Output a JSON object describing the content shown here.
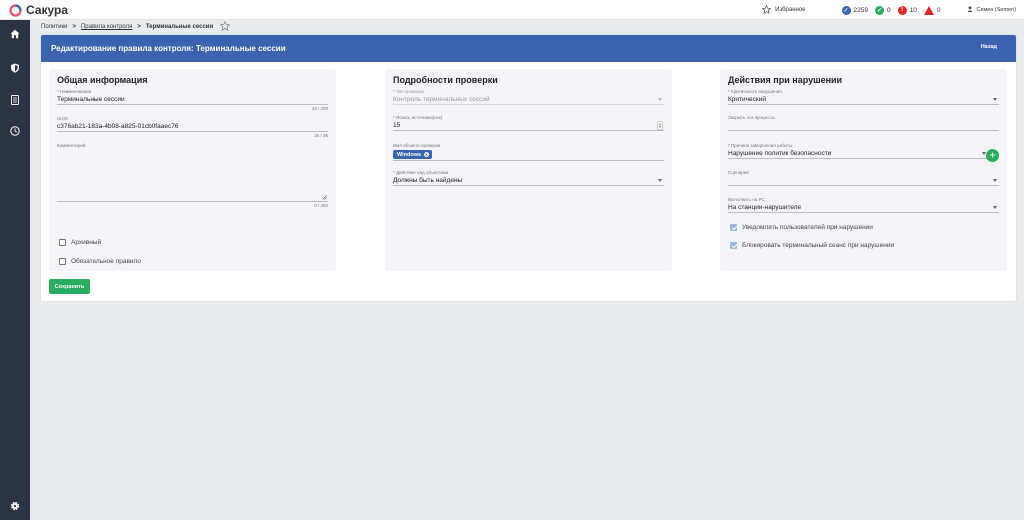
{
  "app": {
    "name": "Сакура"
  },
  "topbar": {
    "favorites_label": "Избранное",
    "counters": [
      {
        "value": "2259",
        "color": "#3a63b0",
        "icon": "check-circle-icon"
      },
      {
        "value": "0",
        "color": "#27ae60",
        "icon": "check-circle-icon"
      },
      {
        "value": "10",
        "color": "#e02424",
        "icon": "exclamation-circle-icon"
      },
      {
        "value": "0",
        "color": "#e02424",
        "icon": "warning-triangle-icon"
      }
    ],
    "user": "Семен (Semen)"
  },
  "sidebar": {
    "items": [
      {
        "icon": "home-icon"
      },
      {
        "icon": "shield-icon"
      },
      {
        "icon": "document-list-icon"
      },
      {
        "icon": "clock-icon"
      }
    ],
    "bottom_icon": "gear-icon"
  },
  "breadcrumb": {
    "items": [
      "Политики",
      "Правила контроля",
      "Терминальные сессии"
    ]
  },
  "card": {
    "title": "Редактирование правила контроля: Терминальные сессии",
    "back_label": "Назад",
    "save_label": "Сохранить"
  },
  "general": {
    "title": "Общая информация",
    "name_label": "* Наименование",
    "name_value": "Терминальные сессии",
    "name_count": "19 / 200",
    "uuid_label": "UUID",
    "uuid_value": "c376ab21-183a-4b08-a825-01cb0faaec76",
    "uuid_count": "36 / 36",
    "comment_label": "Комментарий",
    "comment_count": "0 / 250",
    "archived_label": "Архивный",
    "mandatory_label": "Обязательное правило"
  },
  "details": {
    "title": "Подробности проверки",
    "check_type_label": "* Тип проверки",
    "check_type_value": "Контроль терминальных сессий",
    "search_sources_label": "* Искать источники(сек)",
    "search_sources_value": "15",
    "object_names_label": "Имя объекта проверки",
    "object_chip": "Windows",
    "action_label": "* Действие над объектами",
    "action_value": "Должны быть найдены"
  },
  "violation": {
    "title": "Действия при нарушении",
    "severity_label": "* Критичность нарушения",
    "severity_value": "Критический",
    "close_processes_label": "Закрыть эти процессы",
    "termination_reason_label": "* Причина завершения работы",
    "termination_reason_value": "Нарушение политик безопасности",
    "scenario_label": "Сценарий",
    "execute_on_label": "Выполнить на РС",
    "execute_on_value": "На станции-нарушителе",
    "notify_label": "Уведомлять пользователей при нарушении",
    "block_label": "Блокировать терминальный сеанс при нарушении"
  }
}
